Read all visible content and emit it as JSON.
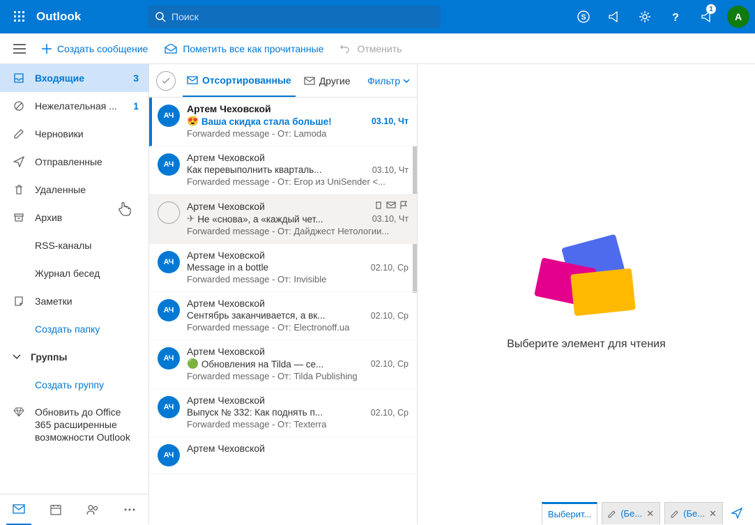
{
  "header": {
    "brand": "Outlook",
    "search_placeholder": "Поиск",
    "notif_count": "1",
    "avatar_initial": "A"
  },
  "commands": {
    "new_message": "Создать сообщение",
    "mark_all_read": "Пометить все как прочитанные",
    "undo": "Отменить"
  },
  "sidebar": {
    "folders": [
      {
        "id": "inbox",
        "label": "Входящие",
        "count": "3",
        "icon": "inbox",
        "active": true
      },
      {
        "id": "junk",
        "label": "Нежелательная ...",
        "count": "1",
        "icon": "blocked"
      },
      {
        "id": "drafts",
        "label": "Черновики",
        "icon": "pencil"
      },
      {
        "id": "sent",
        "label": "Отправленные",
        "icon": "send"
      },
      {
        "id": "deleted",
        "label": "Удаленные",
        "icon": "trash"
      },
      {
        "id": "archive",
        "label": "Архив",
        "icon": "archive"
      },
      {
        "id": "rss",
        "label": "RSS-каналы"
      },
      {
        "id": "conversations",
        "label": "Журнал бесед"
      },
      {
        "id": "notes",
        "label": "Заметки",
        "icon": "note"
      }
    ],
    "create_folder": "Создать папку",
    "groups_label": "Группы",
    "create_group": "Создать группу",
    "upgrade": "Обновить до Office 365 расширенные возможности Outlook"
  },
  "listheader": {
    "tab_focused": "Отсортированные",
    "tab_other": "Другие",
    "filter": "Фильтр"
  },
  "messages": [
    {
      "from": "Артем Чеховской",
      "subject": "Ваша скидка стала больше!",
      "emoji": "😍",
      "date": "03.10, Чт",
      "preview": "Forwarded message - От: Lamoda <newsletter...",
      "unread": true,
      "selected": true,
      "initials": "АЧ"
    },
    {
      "from": "Артем Чеховской",
      "subject": "Как перевыполнить кварталь...",
      "date": "03.10, Чт",
      "preview": "Forwarded message - От: Егор из UniSender <...",
      "initials": "АЧ"
    },
    {
      "from": "Артем Чеховской",
      "subject": "Не «снова», а «каждый чет...",
      "small_icon": "plane",
      "date": "03.10, Чт",
      "preview": "Forwarded message - От: Дайджест Нетологии...",
      "hover": true,
      "initials": "АЧ"
    },
    {
      "from": "Артем Чеховской",
      "subject": "Message in a bottle",
      "date": "02.10, Ср",
      "preview": "Forwarded message - От: Invisible <info@invis...",
      "initials": "АЧ"
    },
    {
      "from": "Артем Чеховской",
      "subject": "Сентябрь заканчивается, а вк...",
      "date": "02.10, Ср",
      "preview": "Forwarded message - От: Electronoff.ua <sales...",
      "initials": "АЧ"
    },
    {
      "from": "Артем Чеховской",
      "subject": "Обновления на Tilda — се...",
      "small_icon": "tilda",
      "date": "02.10, Ср",
      "preview": "Forwarded message - От: Tilda Publishing <hel...",
      "initials": "АЧ"
    },
    {
      "from": "Артем Чеховской",
      "subject": "Выпуск № 332: Как поднять п...",
      "date": "02.10, Ср",
      "preview": "Forwarded message - От: Texterra <partizan@...",
      "initials": "АЧ"
    },
    {
      "from": "Артем Чеховской",
      "subject": "",
      "date": "",
      "preview": "",
      "initials": "АЧ"
    }
  ],
  "reading": {
    "placeholder": "Выберите элемент для чтения",
    "draft_tab1": "Выберит...",
    "draft_tab2": "(Бе...",
    "draft_tab3": "(Бе..."
  }
}
